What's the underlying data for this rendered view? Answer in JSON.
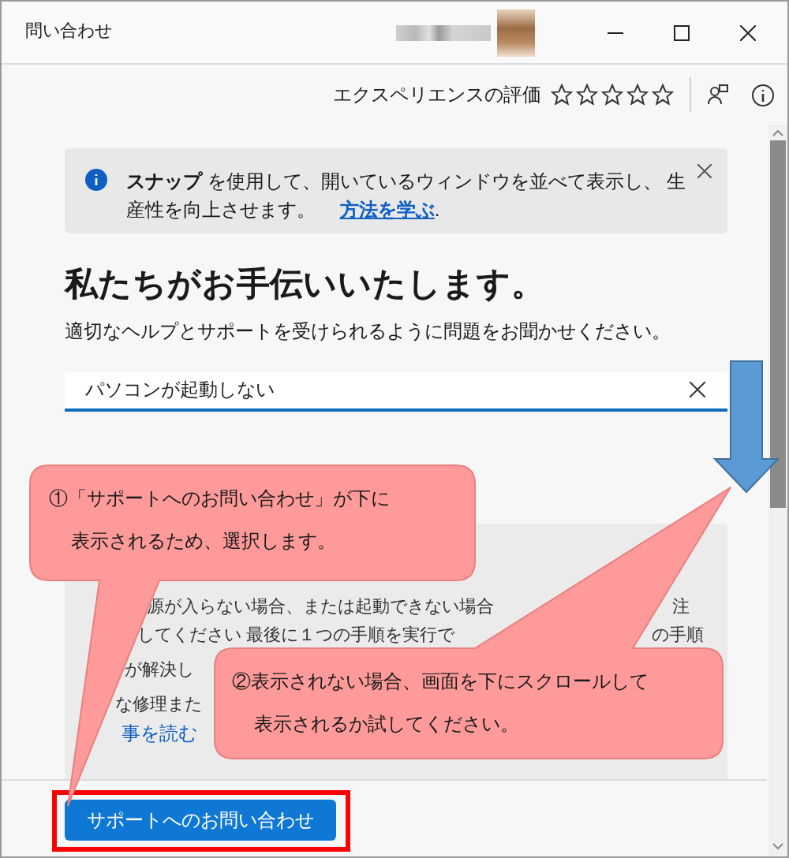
{
  "window": {
    "title": "問い合わせ"
  },
  "rating": {
    "label": "エクスペリエンスの評価",
    "stars": 0
  },
  "banner": {
    "text": "**スナップ** を使用して、開いているウィンドウを並べて表示し、 生産性を向上させます。",
    "link": "方法を学ぶ",
    "after_link": "."
  },
  "heading": "私たちがお手伝いいたします。",
  "subtitle": "適切なヘルプとサポートを受けられるように問題をお聞かせください。",
  "search": {
    "value": "パソコンが起動しない"
  },
  "result_card": {
    "fragments": [
      {
        "kind": "text",
        "text": "源が入らない場合、または起動できない場合"
      },
      {
        "kind": "text",
        "text": "注"
      },
      {
        "kind": "text",
        "text": "してください 最後に１つの手順を実行で"
      },
      {
        "kind": "text",
        "text": "の手順"
      },
      {
        "kind": "text",
        "text": "が解決し"
      },
      {
        "kind": "text",
        "text": "な修理また"
      },
      {
        "kind": "link",
        "text": "事を読む"
      }
    ]
  },
  "contact_button": "サポートへのお問い合わせ",
  "annotations": [
    {
      "lines": [
        "①「サポートへのお問い合わせ」が下に",
        "表示されるため、選択します。"
      ]
    },
    {
      "lines": [
        "②表示されない場合、画面を下にスクロールして",
        "表示されるか試してください。"
      ]
    }
  ]
}
